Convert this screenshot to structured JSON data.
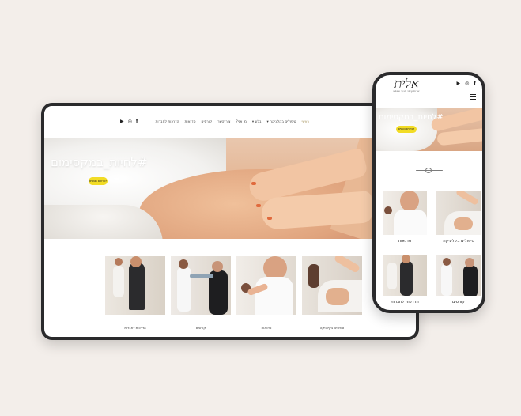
{
  "brand": {
    "logo_text": "אלית",
    "logo_tagline": "שרות עיסוי בגוף ובנפש",
    "accent_color": "#f2dc26"
  },
  "desktop": {
    "social_icons": [
      "facebook-icon",
      "instagram-icon",
      "youtube-icon"
    ],
    "nav": [
      {
        "label": "ראשי",
        "active": true
      },
      {
        "label": "טיפולים בקליניקה ▾",
        "active": false
      },
      {
        "label": "בלוג ▾",
        "active": false
      },
      {
        "label": "מי אני?",
        "active": false
      },
      {
        "label": "צור קשר",
        "active": false
      },
      {
        "label": "קורסים",
        "active": false
      },
      {
        "label": "סדנאות",
        "active": false
      },
      {
        "label": "הדרכות לחברות",
        "active": false
      }
    ],
    "hero": {
      "title": "#לחיות_במקסימום",
      "cta": "לפרטים נוספים"
    },
    "cards": [
      {
        "caption": "הדרכות לחברות"
      },
      {
        "caption": "קורסים"
      },
      {
        "caption": "סדנאות"
      },
      {
        "caption": "טיפולים בקליניקה"
      }
    ]
  },
  "mobile": {
    "social_icons": [
      "youtube-icon",
      "instagram-icon",
      "facebook-icon"
    ],
    "hero": {
      "title": "#לחיות_במקסימום",
      "cta": "לפרטים נוספים"
    },
    "cards": [
      {
        "caption": "סדנאות"
      },
      {
        "caption": "טיפולים בקליניקה"
      },
      {
        "caption": "הדרכות לחברות"
      },
      {
        "caption": "קורסים"
      }
    ]
  }
}
